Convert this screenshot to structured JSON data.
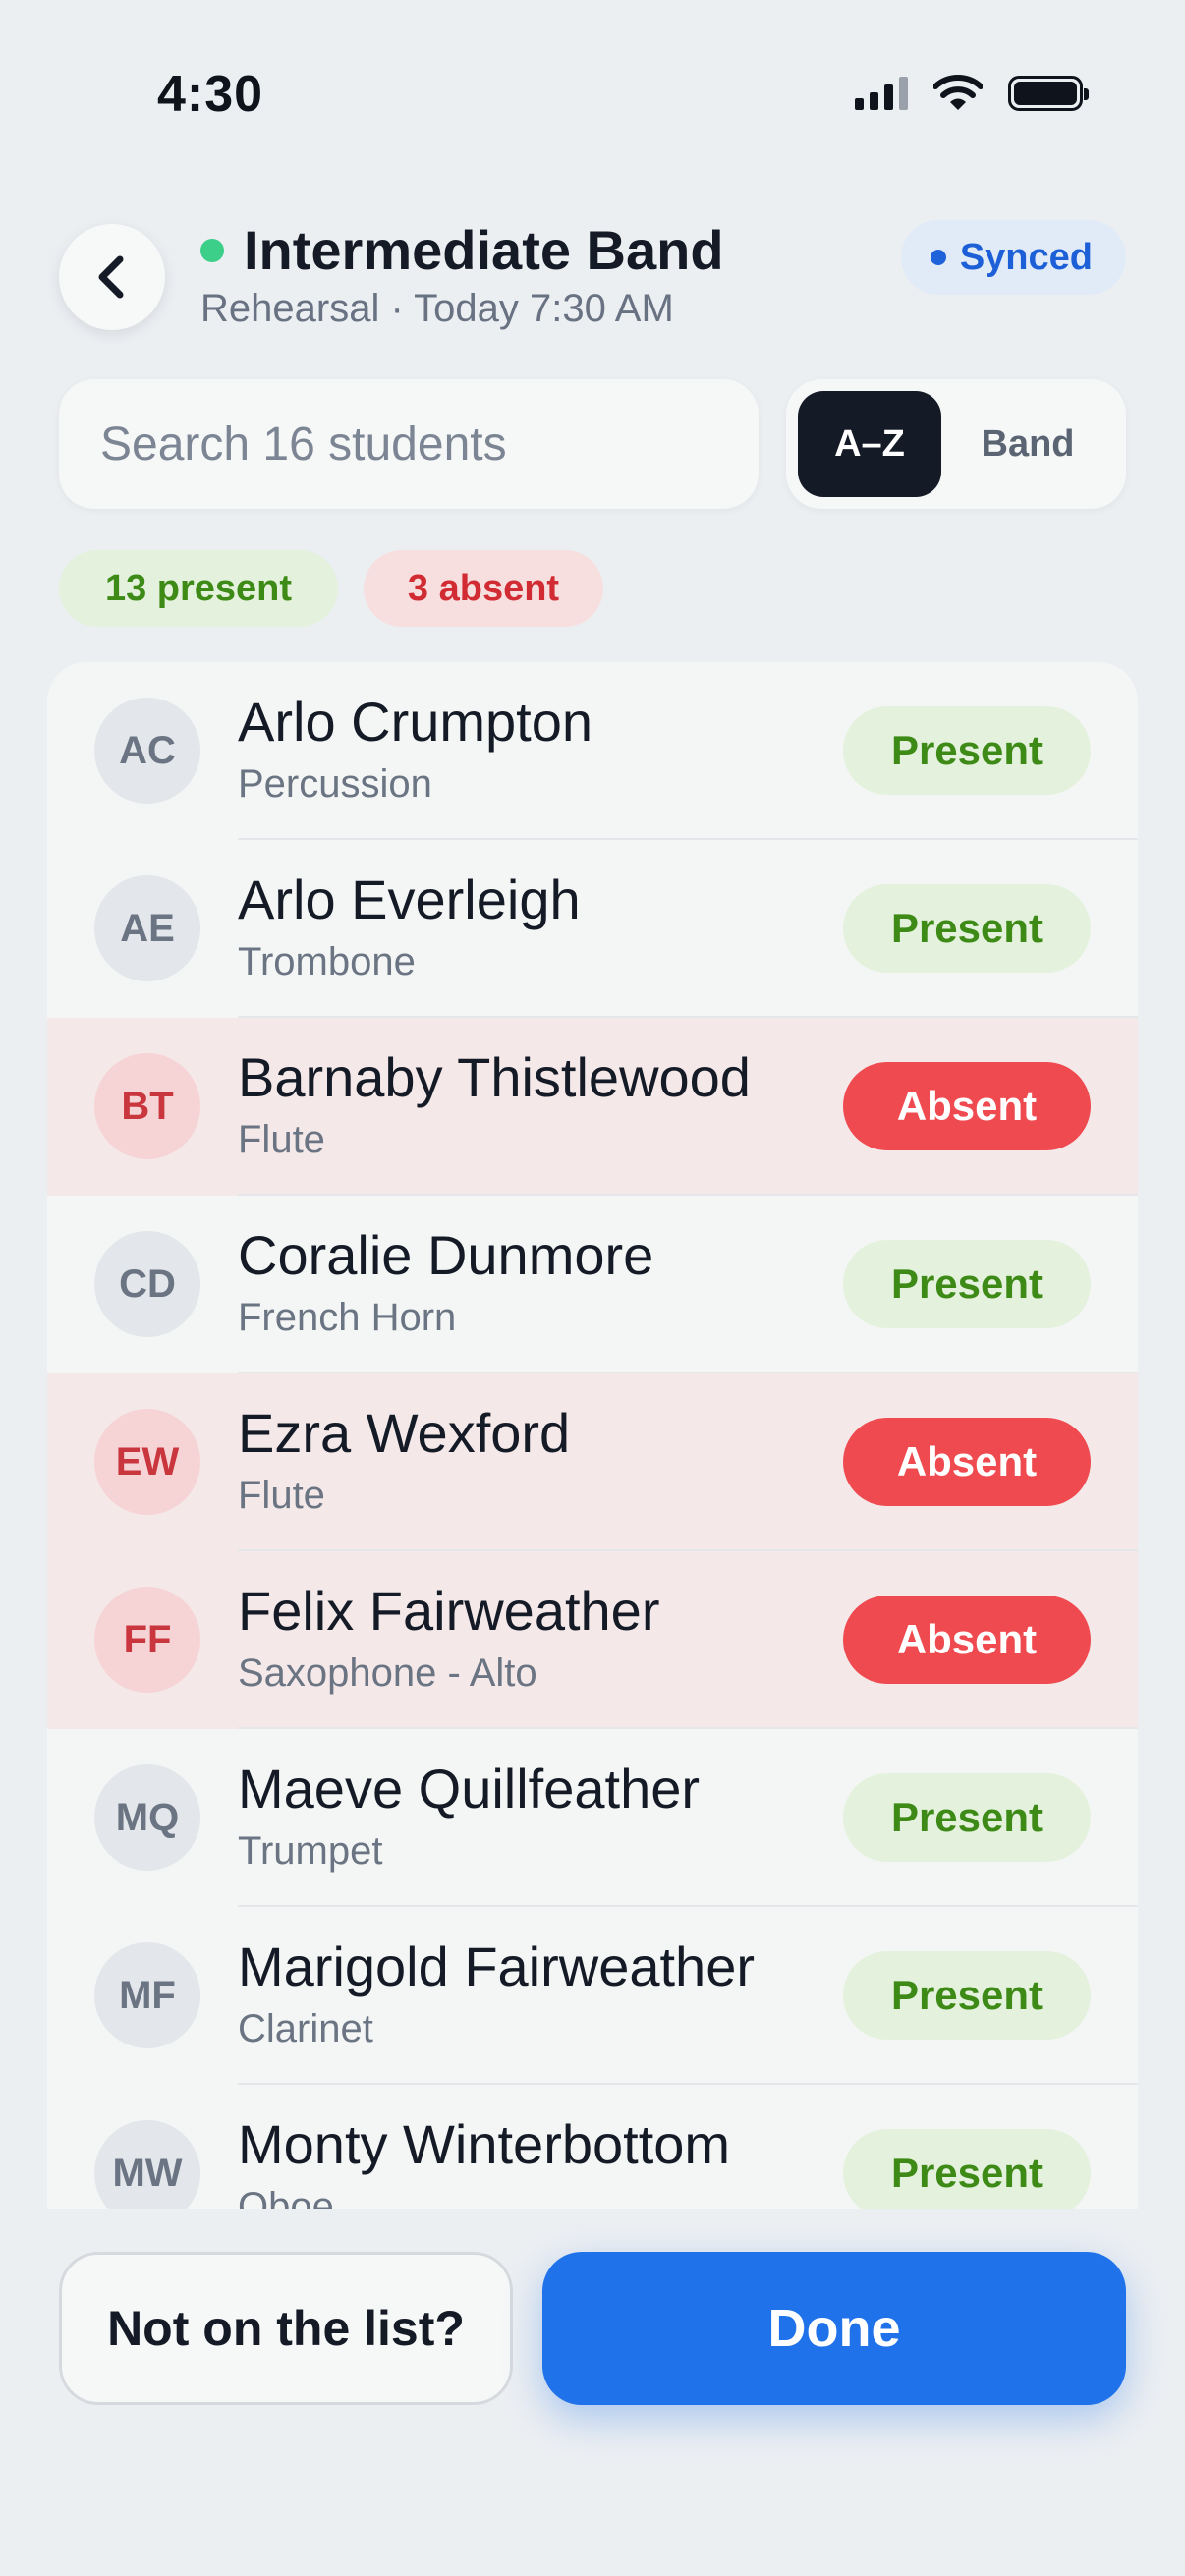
{
  "status_bar": {
    "time": "4:30"
  },
  "header": {
    "title": "Intermediate Band",
    "subtitle": "Rehearsal · Today 7:30 AM",
    "sync_label": "Synced",
    "live_color": "#3ccf8a"
  },
  "search": {
    "placeholder": "Search 16 students",
    "value": ""
  },
  "sort": {
    "options": [
      "A–Z",
      "Band"
    ],
    "selected": "A–Z"
  },
  "summary": {
    "present_label": "13 present",
    "absent_label": "3 absent"
  },
  "roster": [
    {
      "initials": "AC",
      "name": "Arlo Crumpton",
      "instrument": "Percussion",
      "status": "present",
      "status_label": "Present"
    },
    {
      "initials": "AE",
      "name": "Arlo Everleigh",
      "instrument": "Trombone",
      "status": "present",
      "status_label": "Present"
    },
    {
      "initials": "BT",
      "name": "Barnaby Thistlewood",
      "instrument": "Flute",
      "status": "absent",
      "status_label": "Absent"
    },
    {
      "initials": "CD",
      "name": "Coralie Dunmore",
      "instrument": "French Horn",
      "status": "present",
      "status_label": "Present"
    },
    {
      "initials": "EW",
      "name": "Ezra Wexford",
      "instrument": "Flute",
      "status": "absent",
      "status_label": "Absent"
    },
    {
      "initials": "FF",
      "name": "Felix Fairweather",
      "instrument": "Saxophone - Alto",
      "status": "absent",
      "status_label": "Absent"
    },
    {
      "initials": "MQ",
      "name": "Maeve Quillfeather",
      "instrument": "Trumpet",
      "status": "present",
      "status_label": "Present"
    },
    {
      "initials": "MF",
      "name": "Marigold Fairweather",
      "instrument": "Clarinet",
      "status": "present",
      "status_label": "Present"
    },
    {
      "initials": "MW",
      "name": "Monty Winterbottom",
      "instrument": "Oboe",
      "status": "present",
      "status_label": "Present"
    }
  ],
  "actions": {
    "not_listed_label": "Not on the list?",
    "done_label": "Done"
  },
  "colors": {
    "accent": "#1f72ea",
    "present_text": "#3d8a17",
    "present_bg": "#e4f1dd",
    "absent_bg": "#ef4a4f",
    "absent_row": "#f4e8e8"
  },
  "icons": {
    "back": "chevron-left-icon",
    "signal": "cellular-signal-icon",
    "wifi": "wifi-icon",
    "battery": "battery-icon"
  }
}
